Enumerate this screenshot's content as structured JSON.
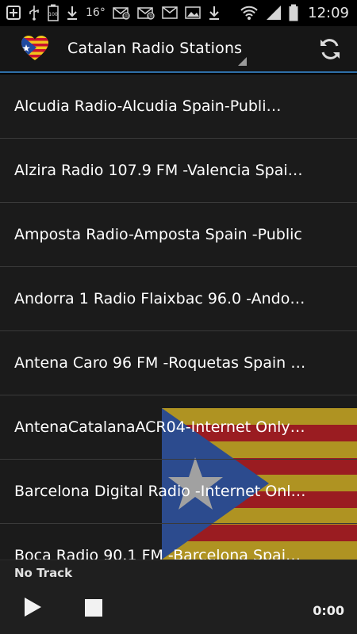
{
  "status_bar": {
    "clock": "12:09",
    "temperature": "16°",
    "icons": [
      "add-icon",
      "usb-icon",
      "battery-100-icon",
      "download-icon",
      "temperature-icon",
      "missed-call-email-icon",
      "email-icon",
      "mail-icon",
      "image-icon",
      "download-icon",
      "wifi-icon",
      "signal-icon",
      "battery-icon"
    ]
  },
  "action_bar": {
    "title": "Catalan Radio Stations",
    "app_icon": "catalan-flag-heart-icon",
    "refresh_icon": "refresh-icon"
  },
  "stations": [
    {
      "label": "Alcudia Radio-Alcudia Spain-Publi…"
    },
    {
      "label": "Alzira Radio 107.9 FM -Valencia Spai…"
    },
    {
      "label": "Amposta Radio-Amposta Spain -Public"
    },
    {
      "label": "Andorra 1 Radio Flaixbac 96.0 -Ando…"
    },
    {
      "label": "Antena Caro 96 FM -Roquetas Spain …"
    },
    {
      "label": "AntenaCatalanaACR04-Internet Only…"
    },
    {
      "label": "Barcelona Digital Radio -Internet Onl…"
    },
    {
      "label": "Boca Radio 90.1 FM -Barcelona Spai…"
    }
  ],
  "player": {
    "track": "No Track",
    "time": "0:00",
    "play_icon": "play-icon",
    "stop_icon": "stop-icon"
  },
  "colors": {
    "accent": "#2f6fa8",
    "flag_yellow": "#f2c41c",
    "flag_red": "#c8102e",
    "flag_blue": "#1f4aa0"
  }
}
